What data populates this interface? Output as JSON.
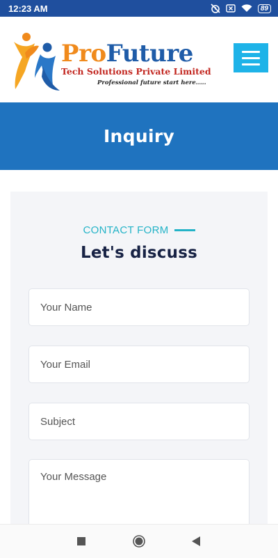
{
  "status_bar": {
    "time": "12:23 AM",
    "battery": "89",
    "icons": [
      "alarm-off-icon",
      "close-box-icon",
      "wifi-icon",
      "battery-icon"
    ]
  },
  "header": {
    "brand_pro": "Pro",
    "brand_future": "Future",
    "tagline": "Tech Solutions Private Limited",
    "motto": "Professional future start here.....",
    "menu_icon": "hamburger-icon"
  },
  "banner": {
    "title": "Inquiry"
  },
  "form": {
    "eyebrow": "CONTACT FORM",
    "heading": "Let's discuss",
    "name_placeholder": "Your Name",
    "email_placeholder": "Your Email",
    "subject_placeholder": "Subject",
    "message_placeholder": "Your Message"
  },
  "nav": {
    "icons": [
      "square-recents-icon",
      "circle-home-icon",
      "triangle-back-icon"
    ]
  },
  "colors": {
    "status_bar": "#1f4f9e",
    "banner": "#1f73bf",
    "accent": "#23b3c7",
    "menu_button": "#1eb3e8",
    "heading": "#172244"
  }
}
